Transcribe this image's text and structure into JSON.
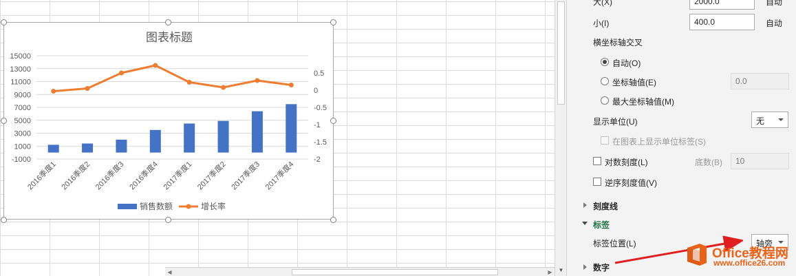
{
  "chart": {
    "title": "图表标题",
    "chart_data": {
      "type": "bar+line",
      "categories": [
        "2016季度1",
        "2016季度2",
        "2016季度3",
        "2016季度4",
        "2017季度1",
        "2017季度2",
        "2017季度3",
        "2017季度4"
      ],
      "series": [
        {
          "name": "销售数额",
          "type": "bar",
          "axis": "left",
          "color": "#4472c4",
          "values": [
            1200,
            1400,
            2000,
            3500,
            4500,
            4900,
            6400,
            7500
          ]
        },
        {
          "name": "增长率",
          "type": "line",
          "axis": "right",
          "color": "#ed7d31",
          "values": [
            -0.03,
            0.05,
            0.5,
            0.72,
            0.23,
            0.08,
            0.28,
            0.15
          ]
        }
      ],
      "left_axis": {
        "min": -1000,
        "max": 15000,
        "ticks": [
          "15000",
          "13000",
          "11000",
          "9000",
          "7000",
          "5000",
          "3000",
          "1000",
          "-1000"
        ]
      },
      "right_axis": {
        "min": -2,
        "max": 1,
        "ticks": [
          "0.5",
          "0",
          "-0.5",
          "-1",
          "-1.5",
          "-2"
        ]
      },
      "grid": true,
      "legend": "bottom"
    }
  },
  "pane": {
    "max_label": "大(X)",
    "max_value": "2000.0",
    "max_auto": "自动",
    "min_label": "小(I)",
    "min_value": "400.0",
    "min_auto": "自动",
    "cross_heading": "横坐标轴交叉",
    "radio_auto": "自动(O)",
    "radio_axis_value": "坐标轴值(E)",
    "axis_value_input": "0.0",
    "radio_max_value": "最大坐标轴值(M)",
    "display_units_label": "显示单位(U)",
    "display_units_value": "无",
    "show_units_label": "在图表上显示单位标签(S)",
    "log_scale_label": "对数刻度(L)",
    "base_label": "底数(B)",
    "base_value": "10",
    "reverse_label": "逆序刻度值(V)",
    "tick_marks_section": "刻度线",
    "labels_section": "标签",
    "label_position_label": "标签位置(L)",
    "label_position_value": "轴旁",
    "number_section": "数字"
  },
  "watermark": {
    "brand_en": "Office",
    "brand_cn": "教程网",
    "url": "www.office26.com",
    "color": "#e8621a"
  }
}
